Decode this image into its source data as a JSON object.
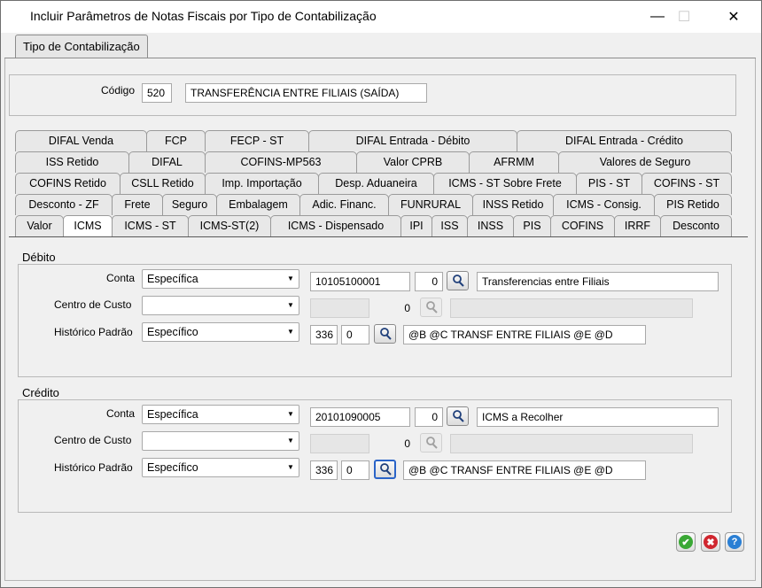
{
  "window": {
    "title": "Incluir Parâmetros de Notas Fiscais por Tipo de Contabilização",
    "minimize": "—",
    "maximize": "☐",
    "close": "✕"
  },
  "outer_tab": {
    "label": "Tipo de Contabilização"
  },
  "header": {
    "codigo_label": "Código",
    "codigo_value": "520",
    "descricao_value": "TRANSFERÊNCIA ENTRE FILIAIS (SAÍDA)"
  },
  "tabs": {
    "row1": [
      "DIFAL Venda",
      "FCP",
      "FECP - ST",
      "DIFAL Entrada - Débito",
      "DIFAL Entrada - Crédito"
    ],
    "row2": [
      "ISS Retido",
      "DIFAL",
      "COFINS-MP563",
      "Valor CPRB",
      "AFRMM",
      "Valores de Seguro"
    ],
    "row3": [
      "COFINS Retido",
      "CSLL Retido",
      "Imp. Importação",
      "Desp. Aduaneira",
      "ICMS - ST Sobre Frete",
      "PIS - ST",
      "COFINS - ST"
    ],
    "row4": [
      "Desconto - ZF",
      "Frete",
      "Seguro",
      "Embalagem",
      "Adic. Financ.",
      "FUNRURAL",
      "INSS Retido",
      "ICMS - Consig.",
      "PIS Retido"
    ],
    "row5": [
      "Valor",
      "ICMS",
      "ICMS - ST",
      "ICMS-ST(2)",
      "ICMS - Dispensado",
      "IPI",
      "ISS",
      "INSS",
      "PIS",
      "COFINS",
      "IRRF",
      "Desconto"
    ],
    "active": "ICMS"
  },
  "debito": {
    "title": "Débito",
    "conta_label": "Conta",
    "conta_type": "Específica",
    "conta_code": "10105100001",
    "conta_num": "0",
    "conta_desc": "Transferencias entre Filiais",
    "cc_label": "Centro de Custo",
    "cc_type": "",
    "cc_num": "0",
    "hist_label": "Histórico Padrão",
    "hist_type": "Específico",
    "hist_code": "336",
    "hist_num": "0",
    "hist_desc": "@B @C TRANSF ENTRE FILIAIS @E @D"
  },
  "credito": {
    "title": "Crédito",
    "conta_label": "Conta",
    "conta_type": "Específica",
    "conta_code": "20101090005",
    "conta_num": "0",
    "conta_desc": "ICMS a Recolher",
    "cc_label": "Centro de Custo",
    "cc_type": "",
    "cc_num": "0",
    "hist_label": "Histórico Padrão",
    "hist_type": "Específico",
    "hist_code": "336",
    "hist_num": "0",
    "hist_desc": "@B @C TRANSF ENTRE FILIAIS @E @D"
  },
  "actions": {
    "confirm_icon": "check-icon",
    "cancel_icon": "x-icon",
    "help_icon": "question-icon",
    "confirm_glyph": "✔",
    "cancel_glyph": "✖",
    "help_glyph": "?",
    "confirm_color": "#3aa835",
    "cancel_color": "#d0262f",
    "help_color": "#2a7fd4"
  }
}
